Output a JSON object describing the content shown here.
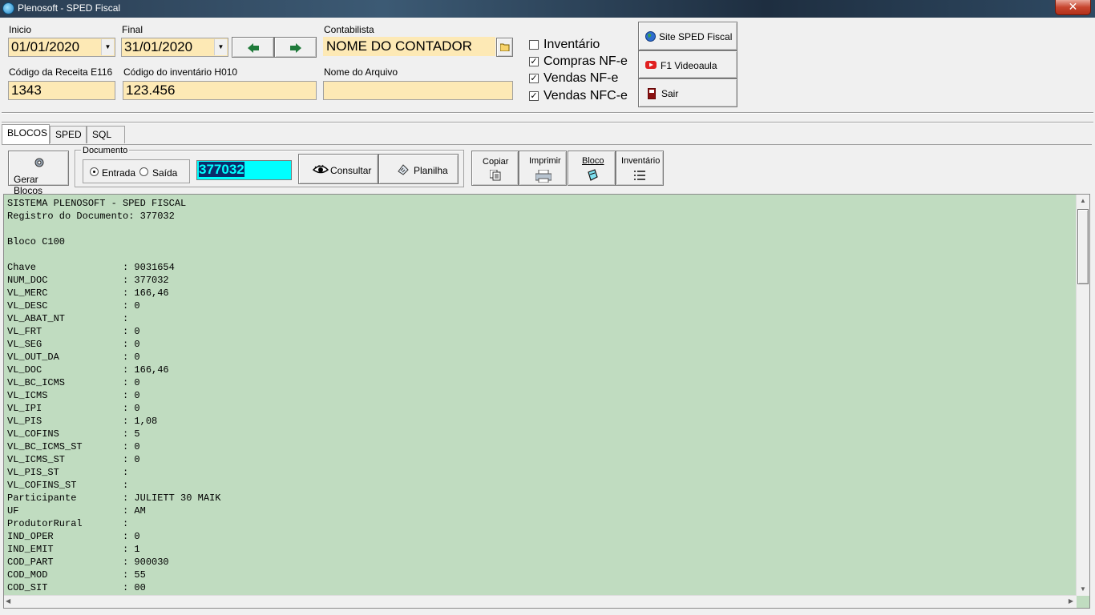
{
  "window": {
    "title": "Plenosoft - SPED Fiscal",
    "close_label": "✕"
  },
  "filters": {
    "inicio_label": "Inicio",
    "inicio_value": "01/01/2020",
    "final_label": "Final",
    "final_value": "31/01/2020",
    "contabilista_label": "Contabilista",
    "contabilista_value": "NOME DO CONTADOR",
    "codigo_receita_label": "Código da Receita E116",
    "codigo_receita_value": "1343",
    "codigo_inventario_label": "Código do inventário H010",
    "codigo_inventario_value": "123.456",
    "nome_arquivo_label": "Nome do Arquivo",
    "nome_arquivo_value": ""
  },
  "options": {
    "inventario": {
      "label": "Inventário",
      "checked": false
    },
    "compras": {
      "label": "Compras NF-e",
      "checked": true
    },
    "vendas_nfe": {
      "label": "Vendas NF-e",
      "checked": true
    },
    "vendas_nfce": {
      "label": "Vendas NFC-e",
      "checked": true
    }
  },
  "side_buttons": {
    "site": "Site SPED Fiscal",
    "videoaula": "F1 Videoaula",
    "sair": "Sair"
  },
  "tabs": [
    "BLOCOS",
    "SPED",
    "SQL"
  ],
  "toolbar": {
    "gerar_blocos": "Gerar Blocos",
    "documento_group": "Documento",
    "entrada": "Entrada",
    "saida": "Saída",
    "documento_value": "377032",
    "consultar": "Consultar",
    "planilha": "Planilha",
    "copiar": "Copiar",
    "imprimir": "Imprimir",
    "bloco": "Bloco",
    "inventario": "Inventário"
  },
  "report": {
    "lines": [
      "SISTEMA PLENOSOFT - SPED FISCAL",
      "Registro do Documento: 377032",
      "",
      "Bloco C100",
      "",
      "Chave               : 9031654",
      "NUM_DOC             : 377032",
      "VL_MERC             : 166,46",
      "VL_DESC             : 0",
      "VL_ABAT_NT          :",
      "VL_FRT              : 0",
      "VL_SEG              : 0",
      "VL_OUT_DA           : 0",
      "VL_DOC              : 166,46",
      "VL_BC_ICMS          : 0",
      "VL_ICMS             : 0",
      "VL_IPI              : 0",
      "VL_PIS              : 1,08",
      "VL_COFINS           : 5",
      "VL_BC_ICMS_ST       : 0",
      "VL_ICMS_ST          : 0",
      "VL_PIS_ST           :",
      "VL_COFINS_ST        :",
      "Participante        : JULIETT 30 MAIK",
      "UF                  : AM",
      "ProdutorRural       :",
      "IND_OPER            : 0",
      "IND_EMIT            : 1",
      "COD_PART            : 900030",
      "COD_MOD             : 55",
      "COD_SIT             : 00"
    ]
  }
}
